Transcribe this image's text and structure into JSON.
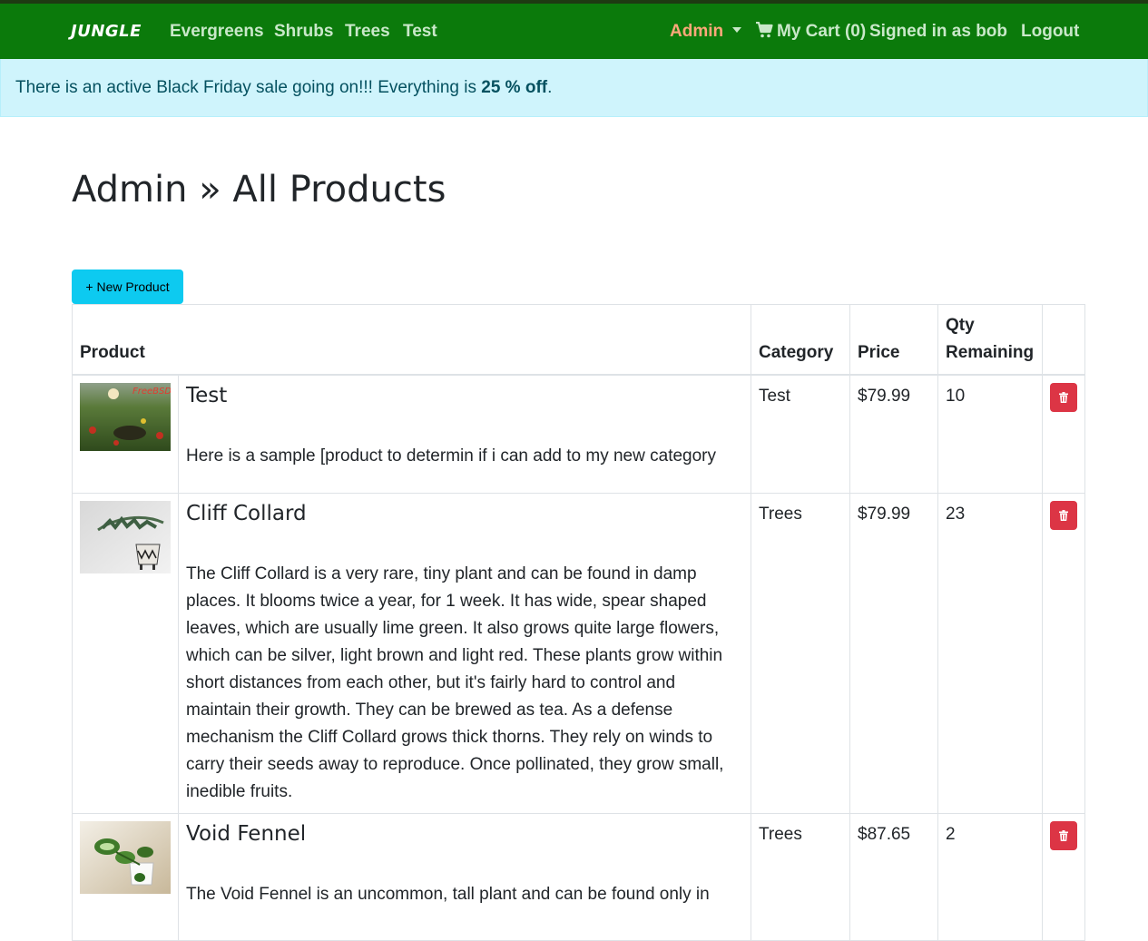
{
  "navbar": {
    "brand": "JUNGLE",
    "links": [
      "Evergreens",
      "Shrubs",
      "Trees",
      "Test"
    ],
    "admin_label": "Admin",
    "cart_label": "My Cart (0)",
    "signed_in": "Signed in as bob",
    "logout": "Logout"
  },
  "alert": {
    "text_before": "There is an active Black Friday sale going on!!! Everything is ",
    "bold": "25 % off",
    "text_after": "."
  },
  "page": {
    "title": "Admin » All Products",
    "new_product_button": "+ New Product"
  },
  "table": {
    "headers": {
      "product": "Product",
      "category": "Category",
      "price": "Price",
      "qty": "Qty Remaining"
    },
    "rows": [
      {
        "name": "Test",
        "description": "Here is a sample [product to determin if i can add to my new category",
        "category": "Test",
        "price": "$79.99",
        "qty": "10"
      },
      {
        "name": "Cliff Collard",
        "description": "The Cliff Collard is a very rare, tiny plant and can be found in damp places. It blooms twice a year, for 1 week. It has wide, spear shaped leaves, which are usually lime green. It also grows quite large flowers, which can be silver, light brown and light red. These plants grow within short distances from each other, but it's fairly hard to control and maintain their growth. They can be brewed as tea. As a defense mechanism the Cliff Collard grows thick thorns. They rely on winds to carry their seeds away to reproduce. Once pollinated, they grow small, inedible fruits.",
        "category": "Trees",
        "price": "$79.99",
        "qty": "23"
      },
      {
        "name": "Void Fennel",
        "description": "The Void Fennel is an uncommon, tall plant and can be found only in",
        "category": "Trees",
        "price": "$87.65",
        "qty": "2"
      }
    ]
  },
  "colors": {
    "navbar_bg": "#0b7a0b",
    "alert_bg": "#cff4fc",
    "new_button_bg": "#0dcaf0",
    "delete_button_bg": "#dc3545",
    "admin_link": "#ffa87a"
  },
  "icons": {
    "cart": "shopping-cart-icon",
    "delete": "trash-icon",
    "dropdown": "caret-down-icon"
  }
}
